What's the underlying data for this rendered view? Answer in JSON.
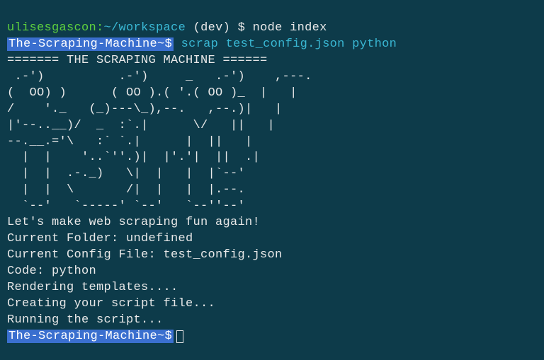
{
  "line1": {
    "user": "ulisesgascon",
    "colon": ":",
    "path": "~/workspace",
    "branch": " (dev) ",
    "dollar": "$ ",
    "cmd": "node index"
  },
  "line2": {
    "prompt": "The-Scraping-Machine~$",
    "space": " ",
    "cmd": "scrap test_config.json python"
  },
  "ascii": {
    "l0": "======= THE SCRAPING MACHINE ======",
    "l1": " .-')          .-')     _   .-')    ,---. ",
    "l2": "(  OO) )      ( OO ).( '.( OO )_  |   | ",
    "l3": "/    '._   (_)---\\_),--.   ,--.)|   | ",
    "l4": "|'--..__)/  _  :`.|      \\/   ||   | ",
    "l5": "--.__.='\\   :` `.|      |  ||   | ",
    "l6": "  |  |    '..`''.)|  |'.'|  ||  .| ",
    "l7": "  |  |  .-._)   \\|  |   |  |`--'  ",
    "l8": "  |  |  \\       /|  |   |  |.--.  ",
    "l9": "  `--'   `-----' `--'   `--''--'  "
  },
  "output": {
    "tagline": "Let's make web scraping fun again!",
    "folder": "Current Folder: undefined",
    "config": "Current Config File: test_config.json",
    "code": "Code: python",
    "render": "Rendering templates....",
    "create": "Creating your script file...",
    "run": "Running the script..."
  },
  "line_end": {
    "prompt": "The-Scraping-Machine~$"
  }
}
